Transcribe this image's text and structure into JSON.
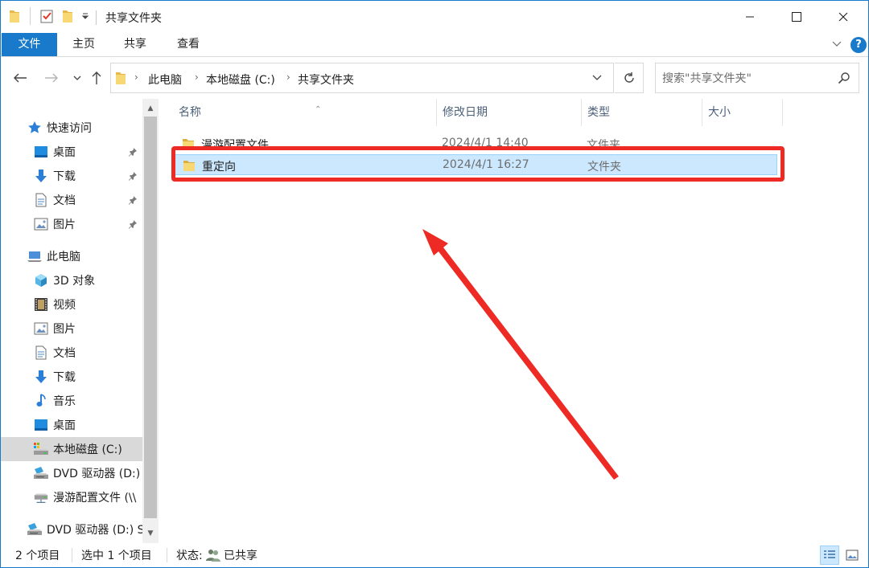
{
  "window": {
    "title": "共享文件夹",
    "accent_color": "#1979ca",
    "quick_access_icons": [
      "folder-icon",
      "properties-checkmark-icon",
      "new-folder-icon",
      "customize-dropdown-icon"
    ],
    "controls": [
      "minimize-icon",
      "maximize-icon",
      "close-icon"
    ]
  },
  "ribbon": {
    "tabs": [
      "文件",
      "主页",
      "共享",
      "查看"
    ],
    "help": "?"
  },
  "navigation": {
    "back_icon": "arrow-left-icon",
    "forward_icon": "arrow-right-icon",
    "recent_icon": "chevron-down-icon",
    "up_icon": "arrow-up-icon"
  },
  "address": {
    "crumbs": [
      "此电脑",
      "本地磁盘 (C:)",
      "共享文件夹"
    ]
  },
  "search": {
    "placeholder": "搜索\"共享文件夹\""
  },
  "sidebar": {
    "items": [
      {
        "label": "快速访问",
        "icon": "star-icon",
        "level": 0,
        "pinned": false,
        "selected": false
      },
      {
        "label": "桌面",
        "icon": "desktop-icon",
        "level": 1,
        "pinned": true,
        "selected": false
      },
      {
        "label": "下载",
        "icon": "download-icon",
        "level": 1,
        "pinned": true,
        "selected": false
      },
      {
        "label": "文档",
        "icon": "document-icon",
        "level": 1,
        "pinned": true,
        "selected": false
      },
      {
        "label": "图片",
        "icon": "picture-icon",
        "level": 1,
        "pinned": true,
        "selected": false
      },
      {
        "label": "此电脑",
        "icon": "computer-icon",
        "level": 0,
        "pinned": false,
        "selected": false
      },
      {
        "label": "3D 对象",
        "icon": "cube-icon",
        "level": 1,
        "pinned": false,
        "selected": false
      },
      {
        "label": "视频",
        "icon": "film-icon",
        "level": 1,
        "pinned": false,
        "selected": false
      },
      {
        "label": "图片",
        "icon": "picture-icon",
        "level": 1,
        "pinned": false,
        "selected": false
      },
      {
        "label": "文档",
        "icon": "document-icon",
        "level": 1,
        "pinned": false,
        "selected": false
      },
      {
        "label": "下载",
        "icon": "download-icon",
        "level": 1,
        "pinned": false,
        "selected": false
      },
      {
        "label": "音乐",
        "icon": "music-icon",
        "level": 1,
        "pinned": false,
        "selected": false
      },
      {
        "label": "桌面",
        "icon": "desktop-icon",
        "level": 1,
        "pinned": false,
        "selected": false
      },
      {
        "label": "本地磁盘 (C:)",
        "icon": "local-disk-icon",
        "level": 1,
        "pinned": false,
        "selected": true
      },
      {
        "label": "DVD 驱动器 (D:)",
        "icon": "dvd-drive-icon",
        "level": 1,
        "pinned": false,
        "selected": false
      },
      {
        "label": "漫游配置文件 (\\\\",
        "icon": "network-drive-icon",
        "level": 1,
        "pinned": false,
        "selected": false
      },
      {
        "label": "DVD 驱动器 (D:) S",
        "icon": "dvd-drive-icon",
        "level": 0,
        "pinned": false,
        "selected": false
      }
    ]
  },
  "columns": [
    "名称",
    "修改日期",
    "类型",
    "大小"
  ],
  "files": [
    {
      "name": "漫游配置文件",
      "modified": "2024/4/1 14:40",
      "type": "文件夹",
      "size": "",
      "icon": "folder-icon",
      "selected": false
    },
    {
      "name": "重定向",
      "modified": "2024/4/1 16:27",
      "type": "文件夹",
      "size": "",
      "icon": "folder-icon",
      "selected": true
    }
  ],
  "status": {
    "count": "2 个项目",
    "selected": "选中 1 个项目",
    "state_label": "状态:",
    "state_icon": "shared-users-icon",
    "state_value": "已共享"
  },
  "annotations": {
    "highlight_color": "#ee2a24"
  }
}
